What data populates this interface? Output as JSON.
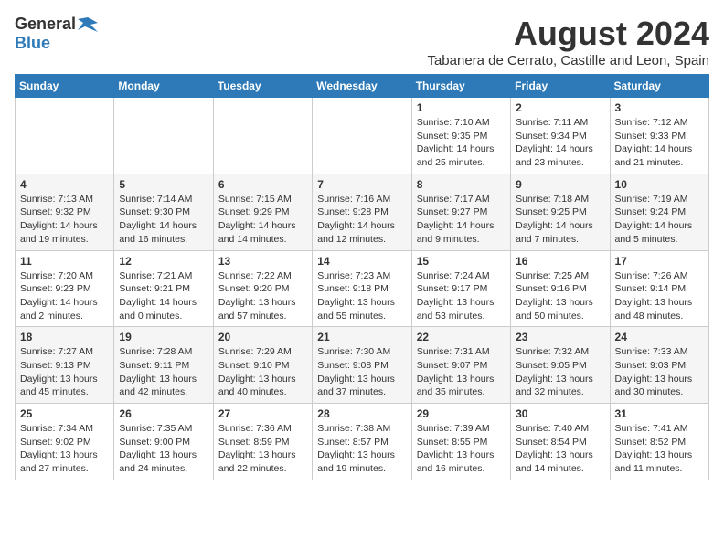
{
  "logo": {
    "general": "General",
    "blue": "Blue"
  },
  "title": {
    "month_year": "August 2024",
    "location": "Tabanera de Cerrato, Castille and Leon, Spain"
  },
  "calendar": {
    "headers": [
      "Sunday",
      "Monday",
      "Tuesday",
      "Wednesday",
      "Thursday",
      "Friday",
      "Saturday"
    ],
    "weeks": [
      [
        {
          "day": "",
          "info": ""
        },
        {
          "day": "",
          "info": ""
        },
        {
          "day": "",
          "info": ""
        },
        {
          "day": "",
          "info": ""
        },
        {
          "day": "1",
          "info": "Sunrise: 7:10 AM\nSunset: 9:35 PM\nDaylight: 14 hours\nand 25 minutes."
        },
        {
          "day": "2",
          "info": "Sunrise: 7:11 AM\nSunset: 9:34 PM\nDaylight: 14 hours\nand 23 minutes."
        },
        {
          "day": "3",
          "info": "Sunrise: 7:12 AM\nSunset: 9:33 PM\nDaylight: 14 hours\nand 21 minutes."
        }
      ],
      [
        {
          "day": "4",
          "info": "Sunrise: 7:13 AM\nSunset: 9:32 PM\nDaylight: 14 hours\nand 19 minutes."
        },
        {
          "day": "5",
          "info": "Sunrise: 7:14 AM\nSunset: 9:30 PM\nDaylight: 14 hours\nand 16 minutes."
        },
        {
          "day": "6",
          "info": "Sunrise: 7:15 AM\nSunset: 9:29 PM\nDaylight: 14 hours\nand 14 minutes."
        },
        {
          "day": "7",
          "info": "Sunrise: 7:16 AM\nSunset: 9:28 PM\nDaylight: 14 hours\nand 12 minutes."
        },
        {
          "day": "8",
          "info": "Sunrise: 7:17 AM\nSunset: 9:27 PM\nDaylight: 14 hours\nand 9 minutes."
        },
        {
          "day": "9",
          "info": "Sunrise: 7:18 AM\nSunset: 9:25 PM\nDaylight: 14 hours\nand 7 minutes."
        },
        {
          "day": "10",
          "info": "Sunrise: 7:19 AM\nSunset: 9:24 PM\nDaylight: 14 hours\nand 5 minutes."
        }
      ],
      [
        {
          "day": "11",
          "info": "Sunrise: 7:20 AM\nSunset: 9:23 PM\nDaylight: 14 hours\nand 2 minutes."
        },
        {
          "day": "12",
          "info": "Sunrise: 7:21 AM\nSunset: 9:21 PM\nDaylight: 14 hours\nand 0 minutes."
        },
        {
          "day": "13",
          "info": "Sunrise: 7:22 AM\nSunset: 9:20 PM\nDaylight: 13 hours\nand 57 minutes."
        },
        {
          "day": "14",
          "info": "Sunrise: 7:23 AM\nSunset: 9:18 PM\nDaylight: 13 hours\nand 55 minutes."
        },
        {
          "day": "15",
          "info": "Sunrise: 7:24 AM\nSunset: 9:17 PM\nDaylight: 13 hours\nand 53 minutes."
        },
        {
          "day": "16",
          "info": "Sunrise: 7:25 AM\nSunset: 9:16 PM\nDaylight: 13 hours\nand 50 minutes."
        },
        {
          "day": "17",
          "info": "Sunrise: 7:26 AM\nSunset: 9:14 PM\nDaylight: 13 hours\nand 48 minutes."
        }
      ],
      [
        {
          "day": "18",
          "info": "Sunrise: 7:27 AM\nSunset: 9:13 PM\nDaylight: 13 hours\nand 45 minutes."
        },
        {
          "day": "19",
          "info": "Sunrise: 7:28 AM\nSunset: 9:11 PM\nDaylight: 13 hours\nand 42 minutes."
        },
        {
          "day": "20",
          "info": "Sunrise: 7:29 AM\nSunset: 9:10 PM\nDaylight: 13 hours\nand 40 minutes."
        },
        {
          "day": "21",
          "info": "Sunrise: 7:30 AM\nSunset: 9:08 PM\nDaylight: 13 hours\nand 37 minutes."
        },
        {
          "day": "22",
          "info": "Sunrise: 7:31 AM\nSunset: 9:07 PM\nDaylight: 13 hours\nand 35 minutes."
        },
        {
          "day": "23",
          "info": "Sunrise: 7:32 AM\nSunset: 9:05 PM\nDaylight: 13 hours\nand 32 minutes."
        },
        {
          "day": "24",
          "info": "Sunrise: 7:33 AM\nSunset: 9:03 PM\nDaylight: 13 hours\nand 30 minutes."
        }
      ],
      [
        {
          "day": "25",
          "info": "Sunrise: 7:34 AM\nSunset: 9:02 PM\nDaylight: 13 hours\nand 27 minutes."
        },
        {
          "day": "26",
          "info": "Sunrise: 7:35 AM\nSunset: 9:00 PM\nDaylight: 13 hours\nand 24 minutes."
        },
        {
          "day": "27",
          "info": "Sunrise: 7:36 AM\nSunset: 8:59 PM\nDaylight: 13 hours\nand 22 minutes."
        },
        {
          "day": "28",
          "info": "Sunrise: 7:38 AM\nSunset: 8:57 PM\nDaylight: 13 hours\nand 19 minutes."
        },
        {
          "day": "29",
          "info": "Sunrise: 7:39 AM\nSunset: 8:55 PM\nDaylight: 13 hours\nand 16 minutes."
        },
        {
          "day": "30",
          "info": "Sunrise: 7:40 AM\nSunset: 8:54 PM\nDaylight: 13 hours\nand 14 minutes."
        },
        {
          "day": "31",
          "info": "Sunrise: 7:41 AM\nSunset: 8:52 PM\nDaylight: 13 hours\nand 11 minutes."
        }
      ]
    ]
  }
}
